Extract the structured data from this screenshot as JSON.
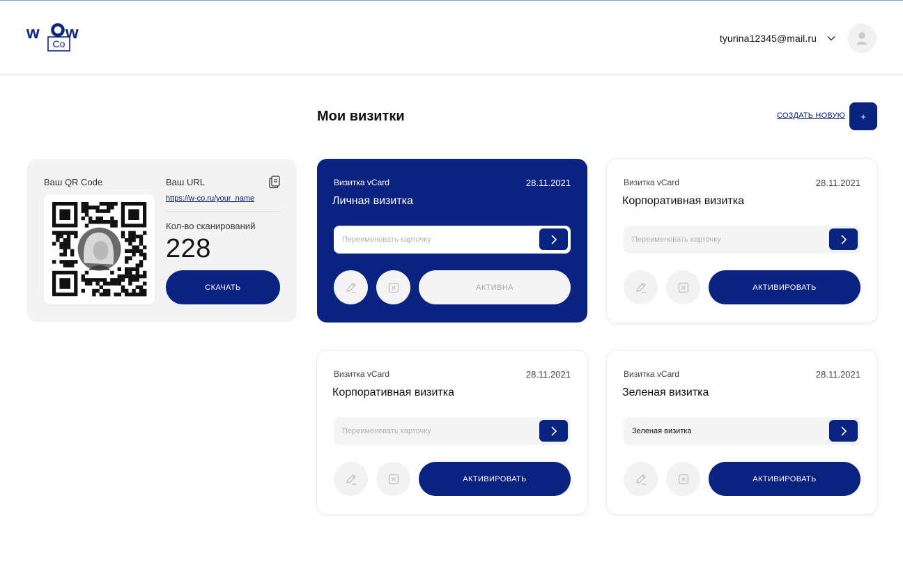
{
  "header": {
    "logo_top": "wow",
    "logo_bottom": "Co",
    "user_email": "tyurina12345@mail.ru"
  },
  "main": {
    "title": "Мои визитки",
    "create_link": "СОЗДАТЬ НОВУЮ",
    "create_button": "+"
  },
  "qr_panel": {
    "qr_label": "Ваш QR Code",
    "url_label": "Ваш URL",
    "url": "https://w-co.ru/your_name",
    "scan_label": "Кол-во сканирований",
    "scan_count": "228",
    "download_label": "СКАЧАТЬ"
  },
  "cards": [
    {
      "type": "Визитка vCard",
      "date": "28.11.2021",
      "title": "Личная визитка",
      "rename_placeholder": "Переименовать карточку",
      "rename_value": "",
      "status_label": "АКТИВНА",
      "active": true
    },
    {
      "type": "Визитка vCard",
      "date": "28.11.2021",
      "title": "Корпоративная визитка",
      "rename_placeholder": "Переименовать карточку",
      "rename_value": "",
      "status_label": "АКТИВИРОВАТЬ",
      "active": false
    },
    {
      "type": "Визитка vCard",
      "date": "28.11.2021",
      "title": "Корпоративная визитка",
      "rename_placeholder": "Переименовать карточку",
      "rename_value": "",
      "status_label": "АКТИВИРОВАТЬ",
      "active": false
    },
    {
      "type": "Визитка vCard",
      "date": "28.11.2021",
      "title": "Зеленая визитка",
      "rename_placeholder": "Переименовать карточку",
      "rename_value": "Зеленая визитка",
      "status_label": "АКТИВИРОВАТЬ",
      "active": false
    }
  ],
  "icons": {
    "user_menu": "chevron-down-icon",
    "avatar": "user-icon",
    "copy": "copy-icon",
    "submit": "chevron-right-icon",
    "edit": "pencil-icon",
    "delete": "close-box-icon"
  },
  "colors": {
    "brand": "#0a2380",
    "panel": "#f3f3f3",
    "muted_button": "#f2f2f2"
  }
}
